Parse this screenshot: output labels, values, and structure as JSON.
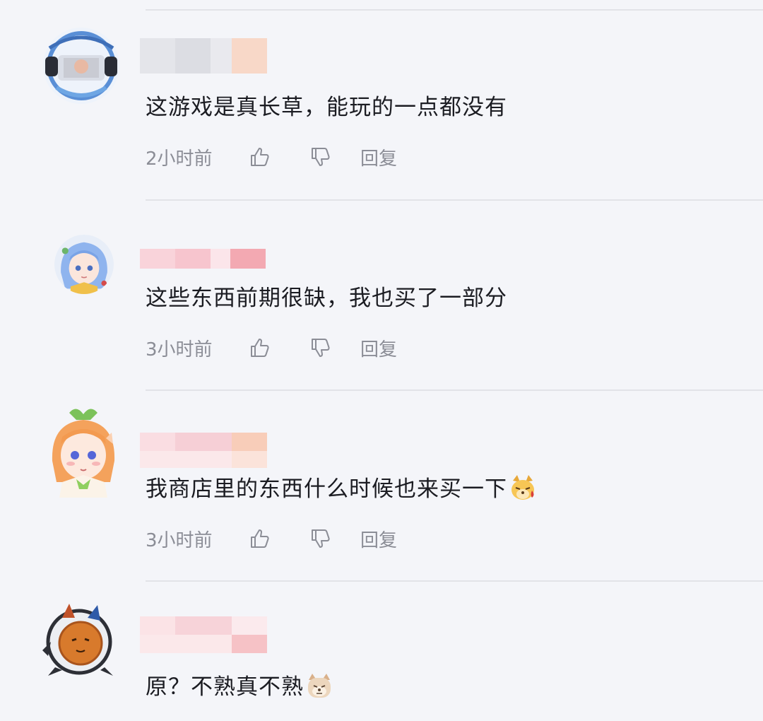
{
  "comments": [
    {
      "text": "这游戏是真长草，能玩的一点都没有",
      "time": "2小时前",
      "reply_label": "回复",
      "username_blur_colors": [
        "#e4e5ea",
        "#dcdde3",
        "#e9e9ee",
        "#f8d8c8"
      ],
      "avatar": "blue-frame-avatar-icon"
    },
    {
      "text": "这些东西前期很缺，我也买了一部分",
      "time": "3小时前",
      "reply_label": "回复",
      "username_blur_colors": [
        "#f9d3da",
        "#f7c5ce",
        "#fbe5ea",
        "#f3a9b2"
      ],
      "avatar": "blue-hair-anime-girl-icon"
    },
    {
      "text": "我商店里的东西什么时候也来买一下",
      "time": "3小时前",
      "reply_label": "回复",
      "username_blur_colors": [
        "#fadde2",
        "#f6cfd6",
        "#fbe8ea",
        "#f8cdb9"
      ],
      "avatar": "orange-hair-anime-girl-icon",
      "emoji": "sweating-dog-face-emoji"
    },
    {
      "text": "原？不熟真不熟",
      "time": "",
      "reply_label": "",
      "username_blur_colors": [
        "#fbe3e6",
        "#f7d3d9",
        "#fbeaed",
        "#f6c2c6"
      ],
      "avatar": "cat-mech-avatar-icon",
      "emoji": "shiba-dog-face-emoji"
    }
  ],
  "icons": {
    "like": "thumbs-up-icon",
    "dislike": "thumbs-down-icon"
  },
  "colors": {
    "background": "#f4f5f9",
    "divider": "#e2e3e8",
    "meta_text": "#8b8d96",
    "comment_text": "#1b1c22"
  }
}
